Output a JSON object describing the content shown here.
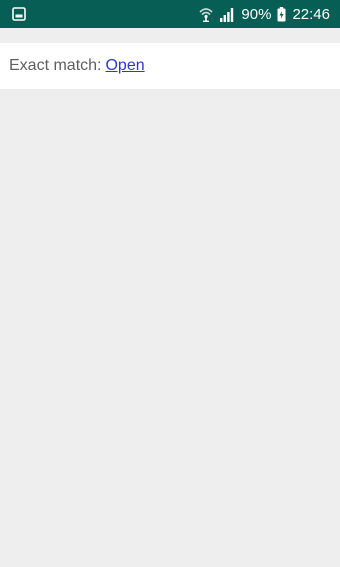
{
  "status_bar": {
    "battery_percent": "90%",
    "time": "22:46",
    "icons": [
      "gallery-icon",
      "wifi-icon",
      "signal-icon",
      "battery-icon"
    ],
    "background_color": "#075e54"
  },
  "result": {
    "label": "Exact match:",
    "link_text": "Open",
    "link_color": "#2d37d6"
  },
  "colors": {
    "page_background": "#eeeeee",
    "panel_background": "#ffffff"
  }
}
